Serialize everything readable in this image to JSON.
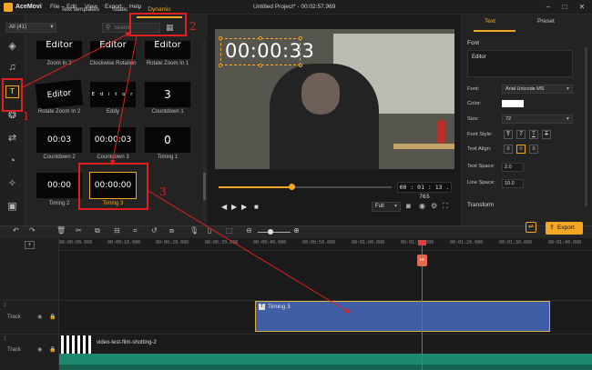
{
  "app": {
    "name": "AceMovi",
    "title": "Untitled Project* - 00:02:57.969",
    "menu": [
      "File",
      "Edit",
      "View",
      "Export",
      "Help"
    ]
  },
  "library": {
    "tabs": [
      "Text templates",
      "Static",
      "Dynamic"
    ],
    "active_tab": "Dynamic",
    "filter": "All (41)",
    "search_placeholder": "Search",
    "items": [
      {
        "preview": "Editor",
        "caption": "Zoom In 2"
      },
      {
        "preview": "Editor",
        "caption": "Clockwise Rotation"
      },
      {
        "preview": "Editor",
        "caption": "Rotate Zoom In 1"
      },
      {
        "preview": "Editor",
        "caption": "Rotate Zoom In 2"
      },
      {
        "preview": "E d i t o r",
        "caption": "Eddy"
      },
      {
        "preview": "3",
        "caption": "Countdown 1"
      },
      {
        "preview": "00:03",
        "caption": "Countdown 2"
      },
      {
        "preview": "00:00:03",
        "caption": "Countdown 3"
      },
      {
        "preview": "0",
        "caption": "Timing 1"
      },
      {
        "preview": "00:00",
        "caption": "Timing 2"
      },
      {
        "preview": "00:00:00",
        "caption": "Timing 3"
      }
    ]
  },
  "preview": {
    "overlay_text": "00:00:33",
    "timecode": "00 : 01 : 13 . 765",
    "quality": "Full",
    "progress_fraction": 0.42
  },
  "properties": {
    "tabs": [
      "Text",
      "Preset"
    ],
    "active_tab": "Text",
    "section_font": "Font",
    "text_value": "Editor",
    "font_label": "Font:",
    "font_value": "Arial Unicode MS",
    "color_label": "Color:",
    "color_value": "#ffffff",
    "size_label": "Size:",
    "size_value": "72",
    "style_label": "Font Style:",
    "style_buttons": [
      "T",
      "T",
      "T",
      "T"
    ],
    "align_label": "Text Align:",
    "text_space_label": "Text Space:",
    "text_space_value": "2.0",
    "line_space_label": "Line Space:",
    "line_space_value": "10.0",
    "section_transform": "Transform"
  },
  "toolbar": {
    "export_label": "Export"
  },
  "timeline": {
    "ruler": [
      "00:00:00.000",
      "00:00:10.000",
      "00:00:20.000",
      "00:00:30.000",
      "00:00:40.000",
      "00:00:50.000",
      "00:01:00.000",
      "00:01:10.000",
      "00:01:20.000",
      "00:01:30.000",
      "00:01:40.000"
    ],
    "tracks": [
      {
        "number": "2",
        "label": "Track"
      },
      {
        "number": "1",
        "label": "Track"
      }
    ],
    "text_clip_label": "Timing 3",
    "video_clip_label": "video-test-film-shotting-2"
  },
  "annotations": {
    "steps": [
      "1",
      "2",
      "3"
    ],
    "color": "#e02020"
  },
  "colors": {
    "accent": "#f5a623",
    "text_clip": "#3f5ea5",
    "video_clip": "#1d8a70",
    "playhead": "#e04040"
  }
}
